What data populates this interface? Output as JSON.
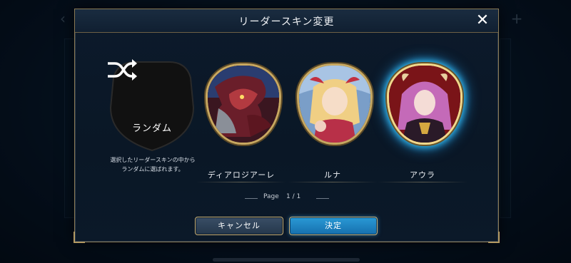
{
  "modal": {
    "title": "リーダースキン変更",
    "close_icon": "close-icon"
  },
  "random": {
    "label": "ランダム",
    "icon": "shuffle-icon",
    "description_line1": "選択したリーダースキンの中から",
    "description_line2": "ランダムに選ばれます。"
  },
  "skins": [
    {
      "name": "ディアロジアーレ",
      "selected": false
    },
    {
      "name": "ルナ",
      "selected": false
    },
    {
      "name": "アウラ",
      "selected": true
    }
  ],
  "pager": {
    "label": "Page",
    "current": "1 / 1"
  },
  "buttons": {
    "cancel_label": "キャンセル",
    "ok_label": "決定"
  },
  "colors": {
    "frame_gold": "#c8a860",
    "selected_glow": "#35c8ff",
    "ok_button": "#2a9ad6",
    "cancel_button": "#3a4f66"
  }
}
